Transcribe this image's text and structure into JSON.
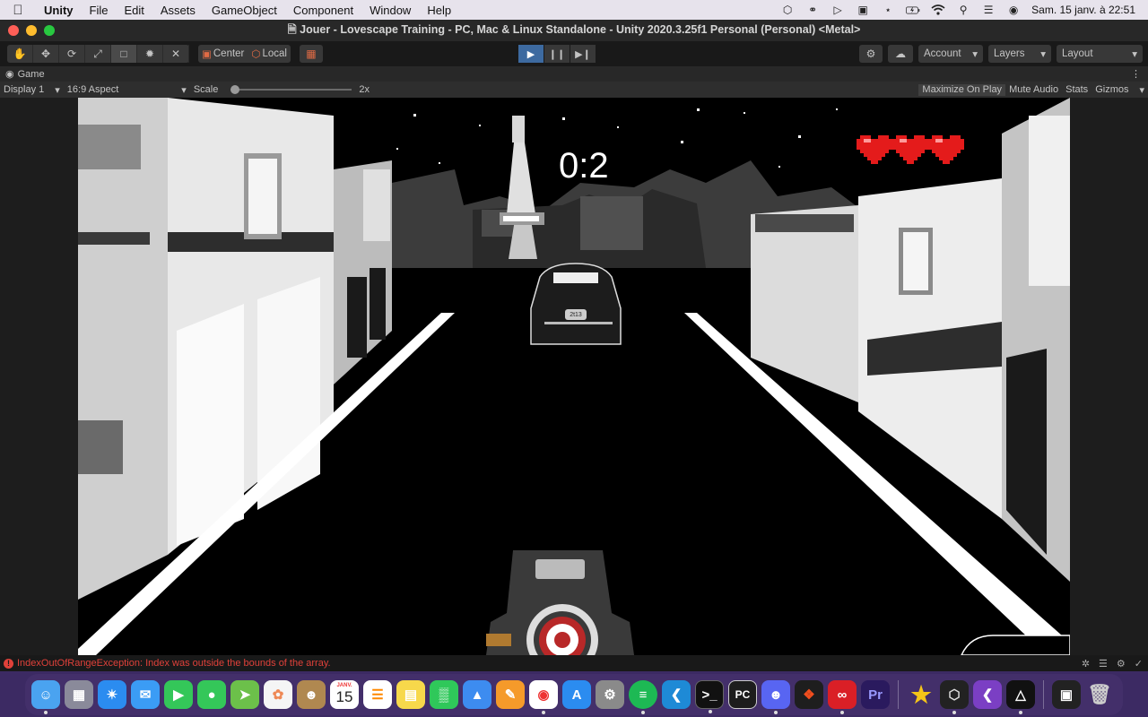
{
  "menubar": {
    "app_name": "Unity",
    "menus": [
      "File",
      "Edit",
      "Assets",
      "GameObject",
      "Component",
      "Window",
      "Help"
    ],
    "clock": "Sam. 15 janv. à  22:51"
  },
  "window": {
    "title": "Jouer - Lovescape Training - PC, Mac & Linux Standalone - Unity 2020.3.25f1 Personal (Personal) <Metal>"
  },
  "toolbar": {
    "pivot_center": "Center",
    "pivot_local": "Local",
    "account": "Account",
    "layers": "Layers",
    "layout": "Layout"
  },
  "game_panel": {
    "tab_label": "Game",
    "display": "Display 1",
    "aspect": "16:9 Aspect",
    "scale_label": "Scale",
    "scale_value": "2x",
    "maximize": "Maximize On Play",
    "mute": "Mute Audio",
    "stats": "Stats",
    "gizmos": "Gizmos"
  },
  "game": {
    "timer": "0:2",
    "lives": 3,
    "front_car_plate": "2t13"
  },
  "console": {
    "error": "IndexOutOfRangeException: Index was outside the bounds of the array."
  },
  "dock": {
    "calendar_month": "JANV.",
    "calendar_day": "15",
    "pc_label": "PC",
    "premiere_label": "Pr",
    "apps": [
      "finder",
      "launchpad",
      "safari",
      "mail",
      "facetime",
      "messages",
      "maps",
      "photos",
      "contacts",
      "calendar",
      "reminders",
      "notes",
      "numbers",
      "keynote",
      "pages",
      "chrome",
      "app-store",
      "system-preferences",
      "spotify",
      "vscode",
      "terminal",
      "pycharm",
      "discord",
      "figma",
      "creative-cloud",
      "premiere",
      "star",
      "unity-hub",
      "visual-studio",
      "unity",
      "screen-recorder",
      "trash"
    ]
  }
}
